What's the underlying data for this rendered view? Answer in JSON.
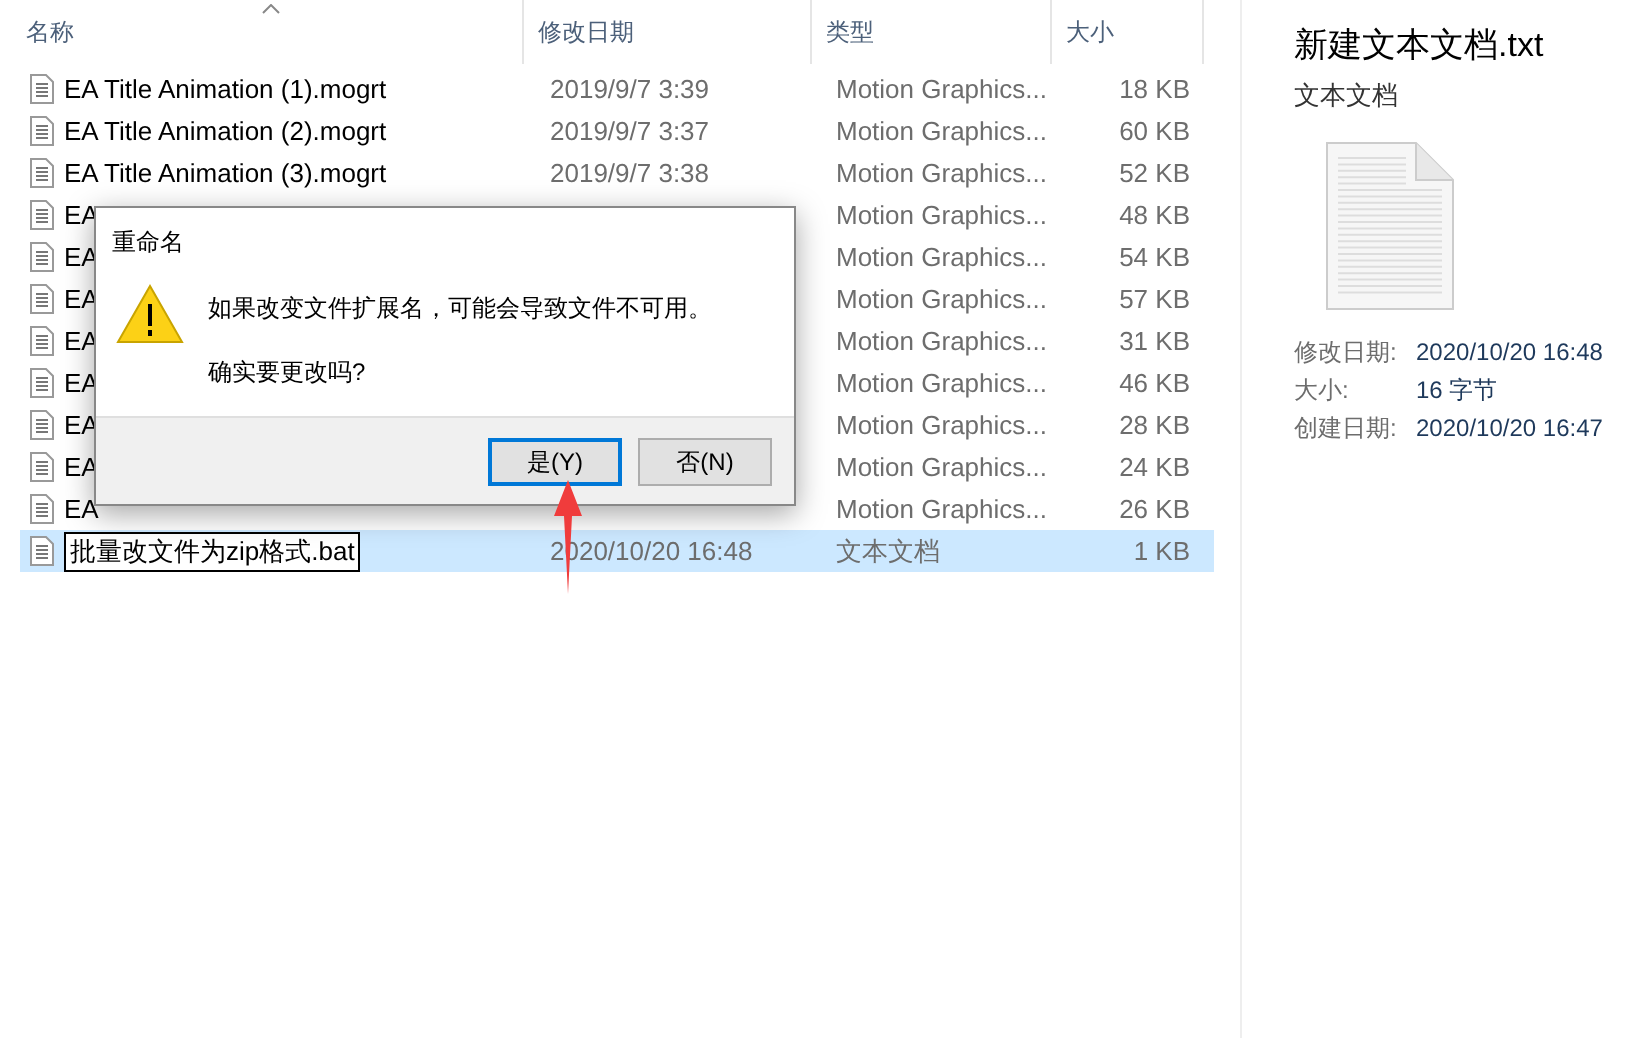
{
  "columns": [
    {
      "label": "名称",
      "sorted": true
    },
    {
      "label": "修改日期",
      "sorted": false
    },
    {
      "label": "类型",
      "sorted": false
    },
    {
      "label": "大小",
      "sorted": false
    }
  ],
  "rows": [
    {
      "name": "EA Title Animation (1).mogrt",
      "date": "2019/9/7 3:39",
      "type": "Motion Graphics...",
      "size": "18 KB",
      "selected": false,
      "editing": false
    },
    {
      "name": "EA Title Animation (2).mogrt",
      "date": "2019/9/7 3:37",
      "type": "Motion Graphics...",
      "size": "60 KB",
      "selected": false,
      "editing": false
    },
    {
      "name": "EA Title Animation (3).mogrt",
      "date": "2019/9/7 3:38",
      "type": "Motion Graphics...",
      "size": "52 KB",
      "selected": false,
      "editing": false
    },
    {
      "name": "EA",
      "type": "Motion Graphics...",
      "size": "48 KB",
      "selected": false,
      "editing": false
    },
    {
      "name": "EA",
      "type": "Motion Graphics...",
      "size": "54 KB",
      "selected": false,
      "editing": false
    },
    {
      "name": "EA",
      "type": "Motion Graphics...",
      "size": "57 KB",
      "selected": false,
      "editing": false
    },
    {
      "name": "EA",
      "type": "Motion Graphics...",
      "size": "31 KB",
      "selected": false,
      "editing": false
    },
    {
      "name": "EA",
      "type": "Motion Graphics...",
      "size": "46 KB",
      "selected": false,
      "editing": false
    },
    {
      "name": "EA",
      "type": "Motion Graphics...",
      "size": "28 KB",
      "selected": false,
      "editing": false
    },
    {
      "name": "EA",
      "type": "Motion Graphics...",
      "size": "24 KB",
      "selected": false,
      "editing": false
    },
    {
      "name": "EA",
      "type": "Motion Graphics...",
      "size": "26 KB",
      "selected": false,
      "editing": false
    },
    {
      "name": "批量改文件为zip格式.bat",
      "date": "2020/10/20 16:48",
      "type": "文本文档",
      "size": "1 KB",
      "selected": true,
      "editing": true
    }
  ],
  "details": {
    "title": "新建文本文档.txt",
    "subtitle": "文本文档",
    "properties": [
      {
        "label": "修改日期:",
        "value": "2020/10/20 16:48"
      },
      {
        "label": "大小:",
        "value": "16 字节"
      },
      {
        "label": "创建日期:",
        "value": "2020/10/20 16:47"
      }
    ]
  },
  "dialog": {
    "title": "重命名",
    "message": "如果改变文件扩展名，可能会导致文件不可用。",
    "question": "确实要更改吗?",
    "buttons": [
      {
        "label": "是(Y)",
        "selected": true
      },
      {
        "label": "否(N)",
        "selected": false
      }
    ]
  }
}
